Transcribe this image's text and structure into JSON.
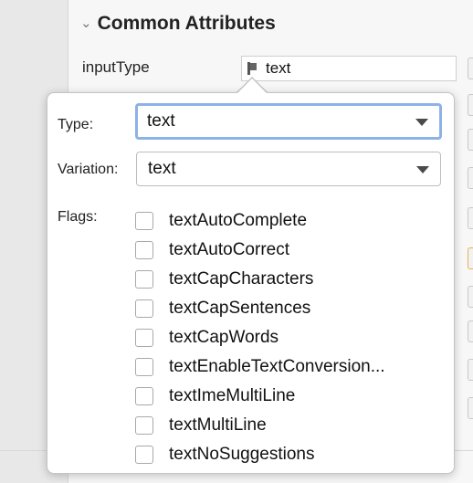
{
  "section": {
    "title": "Common Attributes"
  },
  "attribute": {
    "label": "inputType",
    "value": "text"
  },
  "popup": {
    "type_label": "Type:",
    "type_value": "text",
    "variation_label": "Variation:",
    "variation_value": "text",
    "flags_label": "Flags:",
    "flags": [
      "textAutoComplete",
      "textAutoCorrect",
      "textCapCharacters",
      "textCapSentences",
      "textCapWords",
      "textEnableTextConversion...",
      "textImeMultiLine",
      "textMultiLine",
      "textNoSuggestions"
    ]
  },
  "colors": {
    "focus_ring": "#8db2e6",
    "popup_border": "#c4c4c4"
  }
}
